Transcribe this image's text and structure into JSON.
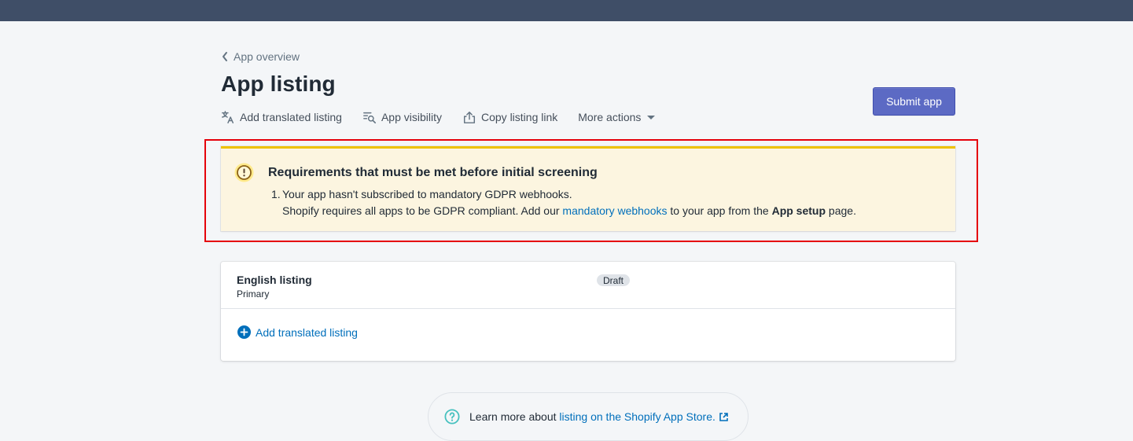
{
  "breadcrumb": {
    "label": "App overview"
  },
  "page": {
    "title": "App listing"
  },
  "actions": {
    "add_translated": "Add translated listing",
    "visibility": "App visibility",
    "copy_link": "Copy listing link",
    "more": "More actions"
  },
  "submit": {
    "label": "Submit app"
  },
  "banner": {
    "title": "Requirements that must be met before initial screening",
    "item_number": "1.",
    "item_line1": "Your app hasn't subscribed to mandatory GDPR webhooks.",
    "item_line2_prefix": "Shopify requires all apps to be GDPR compliant. Add our ",
    "item_link": "mandatory webhooks",
    "item_line2_middle": " to your app from the ",
    "item_bold": "App setup",
    "item_line2_suffix": " page."
  },
  "listing": {
    "name": "English listing",
    "sub": "Primary",
    "status": "Draft",
    "add_label": "Add translated listing"
  },
  "footer": {
    "prefix": "Learn more about ",
    "link": "listing on the Shopify App Store."
  },
  "colors": {
    "topbar": "#3f4e67",
    "primary": "#5c6ac4",
    "link": "#006fbb",
    "warning_bg": "#fcf5e0",
    "warning_border": "#eec200",
    "highlight": "#e5000a",
    "help_icon": "#47c1bf"
  },
  "icons": {
    "back": "chevron-left-icon",
    "translate": "translate-icon",
    "visibility": "search-list-icon",
    "share": "share-icon",
    "dropdown": "caret-down-icon",
    "warning": "alert-circle-icon",
    "add": "circle-plus-icon",
    "help": "question-circle-icon",
    "external": "external-link-icon"
  }
}
